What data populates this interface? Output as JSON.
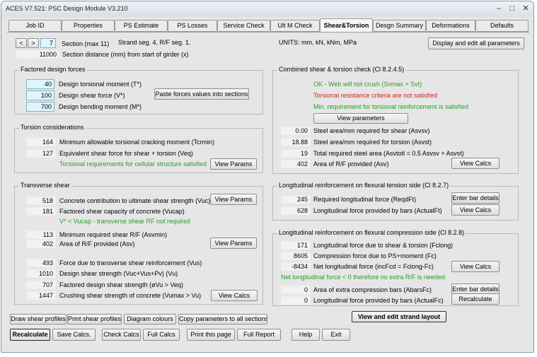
{
  "window": {
    "title": "ACES V7.521: PSC Design Module V3.210",
    "minimize": "–",
    "maximize": "□",
    "close": "✕"
  },
  "tabs": [
    "Job ID",
    "Properties",
    "PS Estimate",
    "PS Losses",
    "Service Check",
    "Ult M Check",
    "Shear&Torsion",
    "Desgn Summary",
    "Deformations",
    "Defaults"
  ],
  "section": {
    "prev": "<",
    "next": ">",
    "number": "7",
    "label": "Section (max 11)",
    "strand_info": "Strand seg.  4, R/F seg.  1.",
    "units": "UNITS: mm, kN, kNm, MPa",
    "distance": "11000",
    "distance_label": "Section distance (mm) from start of girder (x)",
    "display_all_button": "Display and edit all parameters"
  },
  "factored": {
    "title": "Factored design forces",
    "torsion_value": "40",
    "torsion_label": "Design torsional moment (T*)",
    "shear_value": "100",
    "shear_label": "Design shear force (V*)",
    "bending_value": "700",
    "bending_label": "Design bending moment (M*)",
    "paste_button": "Paste forces values into sections"
  },
  "torsion": {
    "title": "Torsion considerations",
    "tcrmin_value": "164",
    "tcrmin_label": "Minimum allowable torsional cracking moment (Tcrmin)",
    "veq_value": "127",
    "veq_label": "Equivalent shear force for shear + torsion (Veq)",
    "status": "Torsional requirements for cellular structure satisfied",
    "view_params": "View Params"
  },
  "transverse": {
    "title": "Transverse shear",
    "vuc_value": "518",
    "vuc_label": "Concrete contribution to ultimate shear strength (Vuc)",
    "view_params1": "View Params",
    "vucap_value": "181",
    "vucap_label": "Factored shear capacity of concrete (Vucap)",
    "status": "V* < Vucap - transverse shear RF not required",
    "asvmin_value": "113",
    "asvmin_label": "Minimum required shear R/F (Asvmin)",
    "asv_value": "402",
    "asv_label": "Area of R/F provided (Asv)",
    "view_params2": "View Params",
    "vus_value": "493",
    "vus_label": "Force due to transverse shear reinforcement (Vus)",
    "vu_value": "1010",
    "vu_label": "Design shear strength (Vuc+Vus+Pv) (Vu)",
    "phivu_value": "707",
    "phivu_label": "Factored design shear strength (øVu > Veq)",
    "vumax_value": "1447",
    "vumax_label": "Crushing shear strength of concrete (Vumax > Vu)",
    "view_calcs": "View Calcs"
  },
  "combined": {
    "title": "Combined shear & torsion check (Cl 8.2.4.5)",
    "status1": "OK - Web will not crush (Svmax > Svt)",
    "status2": "Torsional resistance criteria are not satisfied",
    "status3": "Min. requirement for torsional reinforcement is satisfied",
    "view_params": "View parameters",
    "asvs_value": "0.00",
    "asvs_label": "Steel area/mm required for shear (Asvsv)",
    "asvst_value": "18.88",
    "asvst_label": "Steel area/mm required for torsion (Asvst)",
    "asvtotl_value": "19",
    "asvtotl_label": "Total required steel area (Asvtotl = 0.5 Asvsv + Asvst)",
    "asv_value": "402",
    "asv_label": "Area of R/F provided (Asv)",
    "view_calcs": "View Calcs"
  },
  "long_tension": {
    "title": "Longitudinal reinforcement on flexural tension side  (Cl 8.2.7)",
    "reqdft_value": "245",
    "reqdft_label": "Required longitudinal force (ReqdFt)",
    "actualft_value": "628",
    "actualft_label": "Longitudinal force provided by bars (ActualFt)",
    "enter_bar": "Enter bar details",
    "view_calcs": "View Calcs"
  },
  "long_compression": {
    "title": "Longitudinal reinforcement on flexural compression side  (Cl 8.2.8)",
    "fclong_value": "171",
    "fclong_label": "Longitudinal force due to shear & torsion (Fclong)",
    "fc_value": "8605",
    "fc_label": "Compression force due to PS+moment (Fc)",
    "incfcd_value": "-8434",
    "incfcd_label": "Net longitudinal force (incFcd = Fclong-Fc)",
    "view_calcs": "View Calcs",
    "status": "Net longitudinal force < 0 therefore no extra R/F is needed",
    "abarsfc_value": "0",
    "abarsfc_label": "Area of extra compression bars (AbarsFc)",
    "actualfc_value": "0",
    "actualfc_label": "Longitudinal force provided by bars (ActualFc)",
    "enter_bar": "Enter bar details",
    "recalculate": "Recalculate"
  },
  "bottom": {
    "draw_profiles": "Draw shear profiles",
    "print_profiles": "Print shear profiles",
    "diagram_colours": "Diagram colours",
    "copy_params": "Copy parameters to all sections",
    "strand_layout": "View and edit strand layout",
    "recalculate": "Recalculate",
    "save_calcs": "Save Calcs.",
    "check_calcs": "Check Calcs",
    "full_calcs": "Full Calcs",
    "print_page": "Print this page",
    "full_report": "Full Report",
    "help": "Help",
    "exit": "Exit"
  }
}
